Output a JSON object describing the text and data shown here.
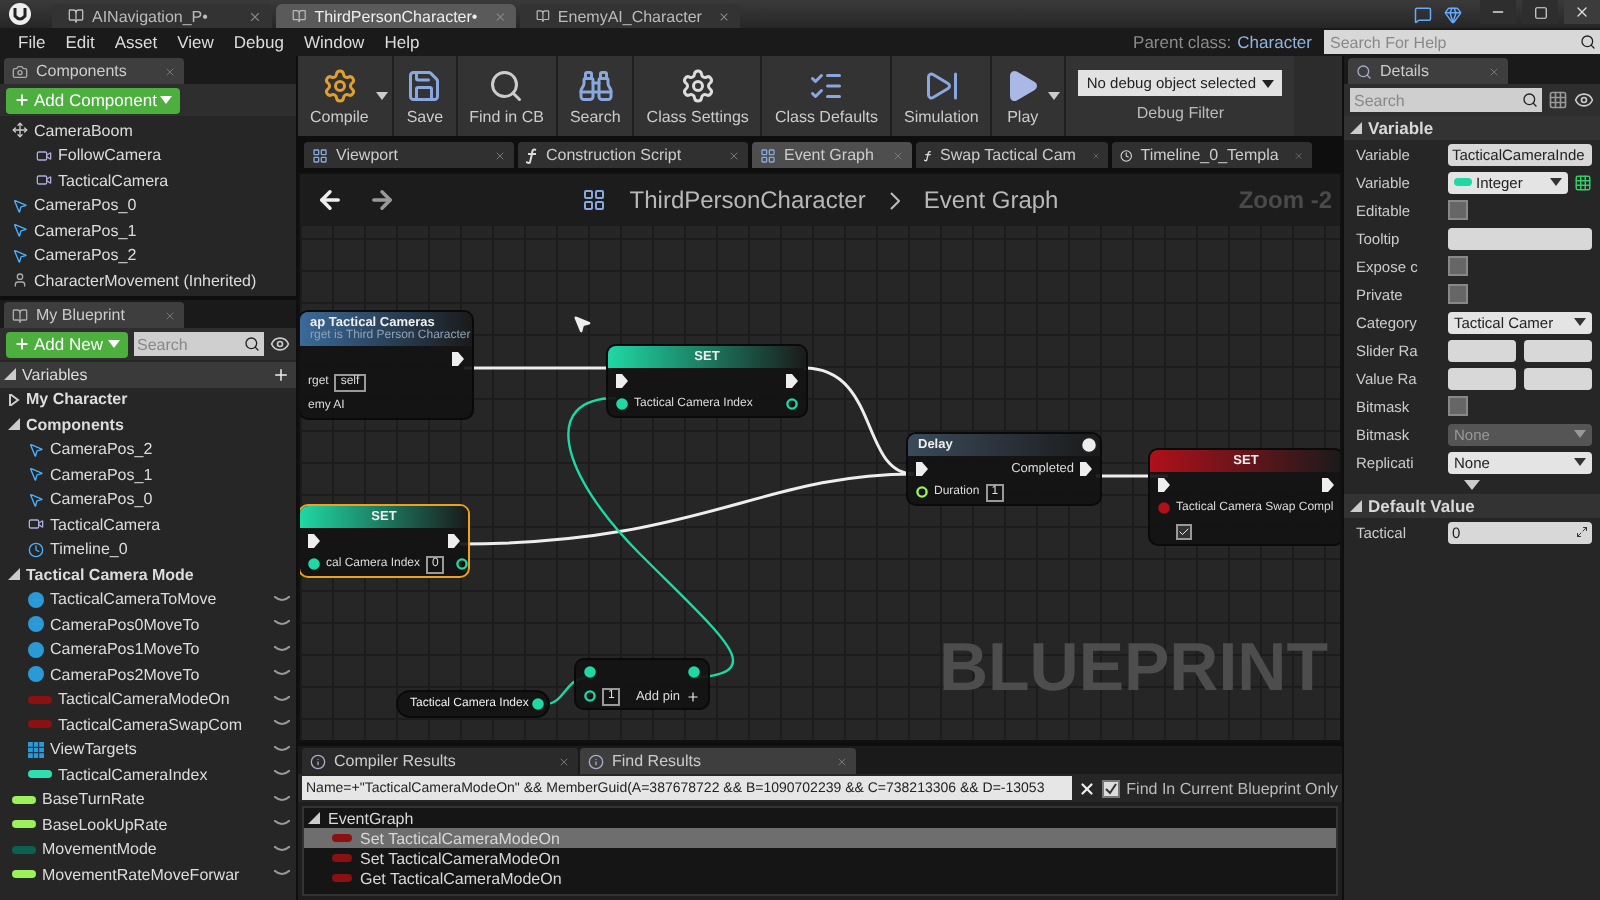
{
  "title_bar": {
    "tabs": [
      {
        "label": "AINavigation_P•",
        "selected": false
      },
      {
        "label": "ThirdPersonCharacter•",
        "selected": true
      },
      {
        "label": "EnemyAI_Character",
        "selected": false
      }
    ]
  },
  "menu": [
    "File",
    "Edit",
    "Asset",
    "View",
    "Debug",
    "Window",
    "Help"
  ],
  "parent_class": {
    "label": "Parent class:",
    "value": "Character"
  },
  "help_search": {
    "placeholder": "Search For Help"
  },
  "components_panel": {
    "tab": "Components",
    "add_button": "Add Component",
    "items": [
      {
        "label": "CameraBoom",
        "kind": "spring_arm",
        "children": [
          {
            "label": "FollowCamera",
            "kind": "camera"
          },
          {
            "label": "TacticalCamera",
            "kind": "camera"
          }
        ]
      },
      {
        "label": "CameraPos_0",
        "kind": "scene"
      },
      {
        "label": "CameraPos_1",
        "kind": "scene"
      },
      {
        "label": "CameraPos_2",
        "kind": "scene"
      },
      {
        "label": "CharacterMovement (Inherited)",
        "kind": "movement"
      }
    ]
  },
  "my_blueprint": {
    "tab": "My Blueprint",
    "add_button": "Add New",
    "search": {
      "placeholder": "Search"
    },
    "items": [
      {
        "label": "Variables",
        "kind": "header",
        "expanded": true,
        "children": [
          {
            "label": "My Character",
            "kind": "category",
            "expanded": false
          },
          {
            "label": "Components",
            "kind": "category",
            "expanded": true,
            "children": [
              {
                "label": "CameraPos_2",
                "kind": "scene"
              },
              {
                "label": "CameraPos_1",
                "kind": "scene"
              },
              {
                "label": "CameraPos_0",
                "kind": "scene"
              },
              {
                "label": "TacticalCamera",
                "kind": "camera"
              },
              {
                "label": "Timeline_0",
                "kind": "timeline"
              }
            ]
          },
          {
            "label": "Tactical Camera Mode",
            "kind": "category",
            "expanded": true,
            "children": [
              {
                "label": "TacticalCameraToMove",
                "kind": "object",
                "color": "#2a9ad6"
              },
              {
                "label": "CameraPos0MoveTo",
                "kind": "object",
                "color": "#2a9ad6"
              },
              {
                "label": "CameraPos1MoveTo",
                "kind": "object",
                "color": "#2a9ad6"
              },
              {
                "label": "CameraPos2MoveTo",
                "kind": "object",
                "color": "#2a9ad6"
              },
              {
                "label": "TacticalCameraModeOn",
                "kind": "variable",
                "color": "#8b1010"
              },
              {
                "label": "TacticalCameraSwapCom",
                "kind": "variable",
                "color": "#8b1010"
              },
              {
                "label": "ViewTargets",
                "kind": "array",
                "color": "#2a9ad6"
              },
              {
                "label": "TacticalCameraIndex",
                "kind": "variable",
                "color": "#2ee0b0"
              }
            ]
          },
          {
            "label": "BaseTurnRate",
            "kind": "variable",
            "color": "#9cf05a"
          },
          {
            "label": "BaseLookUpRate",
            "kind": "variable",
            "color": "#9cf05a"
          },
          {
            "label": "MovementMode",
            "kind": "variable",
            "color": "#0b6050"
          },
          {
            "label": "MovementRateMoveForwar",
            "kind": "variable",
            "color": "#9cf05a"
          }
        ]
      }
    ]
  },
  "toolbar": {
    "buttons": [
      {
        "label": "Compile",
        "kind": "compile",
        "dropdown": true
      },
      {
        "label": "Save",
        "kind": "save",
        "dropdown": false
      },
      {
        "label": "Find in CB",
        "kind": "find",
        "dropdown": false
      },
      {
        "label": "Search",
        "kind": "search",
        "dropdown": false
      },
      {
        "label": "Class Settings",
        "kind": "settings",
        "dropdown": false
      },
      {
        "label": "Class Defaults",
        "kind": "defaults",
        "dropdown": false
      },
      {
        "label": "Simulation",
        "kind": "simulation",
        "dropdown": false
      },
      {
        "label": "Play",
        "kind": "play",
        "dropdown": true
      }
    ],
    "debug": {
      "value": "No debug object selected",
      "label": "Debug Filter"
    }
  },
  "doc_tabs": [
    {
      "label": "Viewport",
      "kind": "viewport",
      "selected": false
    },
    {
      "label": "Construction Script",
      "kind": "function",
      "selected": false
    },
    {
      "label": "Event Graph",
      "kind": "graph",
      "selected": true
    },
    {
      "label": "Swap Tactical Cam",
      "kind": "function",
      "selected": false
    },
    {
      "label": "Timeline_0_Templa",
      "kind": "timeline",
      "selected": false
    }
  ],
  "graph": {
    "breadcrumb": [
      "ThirdPersonCharacter",
      "Event Graph"
    ],
    "zoom": "Zoom -2",
    "watermark": "BLUEPRINT",
    "nodes": [
      {
        "kind": "event",
        "title": "ap Tactical Cameras",
        "subtitle": "rget is Third Person Character",
        "pins": [
          {
            "label": "rget",
            "value": "self"
          },
          {
            "label": "emy AI"
          }
        ],
        "selected": false
      },
      {
        "kind": "set",
        "color": "#1fd8a4",
        "title": "SET",
        "pins": [
          {
            "label": "Tactical Camera Index"
          }
        ],
        "selected": false
      },
      {
        "kind": "delay",
        "title": "Delay",
        "output": "Completed",
        "pins": [
          {
            "label": "Duration",
            "value": "1"
          }
        ],
        "selected": false
      },
      {
        "kind": "set",
        "color": "#b0101a",
        "title": "SET",
        "pins": [
          {
            "label": "Tactical Camera Swap Compl",
            "checked": true
          }
        ],
        "selected": false
      },
      {
        "kind": "set",
        "color": "#1fd8a4",
        "title": "SET",
        "pins": [
          {
            "label": "cal Camera Index",
            "value": "0"
          }
        ],
        "selected": true
      },
      {
        "kind": "getter",
        "color": "#1fd8a4",
        "title": "Tactical Camera Index",
        "selected": false
      },
      {
        "kind": "operator",
        "pins": [
          {
            "value": "1"
          }
        ],
        "add_pin": "Add pin",
        "selected": false
      }
    ]
  },
  "results_panel": {
    "tabs": [
      {
        "label": "Compiler Results",
        "selected": false
      },
      {
        "label": "Find Results",
        "selected": true
      }
    ],
    "query": "Name=+\"TacticalCameraModeOn\" && MemberGuid(A=387678722 && B=1090702239 && C=738213306 && D=-13053",
    "option": {
      "label": "Find In Current Blueprint Only",
      "checked": true
    },
    "results": [
      {
        "label": "EventGraph",
        "expanded": true,
        "children": [
          {
            "label": "Set TacticalCameraModeOn",
            "selected": true
          },
          {
            "label": "Set TacticalCameraModeOn",
            "selected": false
          },
          {
            "label": "Get TacticalCameraModeOn",
            "selected": false
          }
        ]
      }
    ]
  },
  "details": {
    "tab": "Details",
    "search": {
      "placeholder": "Search"
    },
    "sections": [
      {
        "title": "Variable",
        "expanded": true,
        "rows": [
          {
            "label": "Variable",
            "kind": "field",
            "value": "TacticalCameraInde"
          },
          {
            "label": "Variable",
            "kind": "type",
            "value": "Integer"
          },
          {
            "label": "Editable",
            "kind": "checkbox",
            "checked": false
          },
          {
            "label": "Tooltip",
            "kind": "field"
          },
          {
            "label": "Expose c",
            "kind": "checkbox",
            "checked": false
          },
          {
            "label": "Private",
            "kind": "checkbox",
            "checked": false
          },
          {
            "label": "Category",
            "kind": "dropdown",
            "value": "Tactical Camer",
            "disabled": false
          },
          {
            "label": "Slider Ra",
            "kind": "range"
          },
          {
            "label": "Value Ra",
            "kind": "range"
          },
          {
            "label": "Bitmask",
            "kind": "checkbox",
            "checked": false
          },
          {
            "label": "Bitmask",
            "kind": "dropdown",
            "value": "None",
            "disabled": true
          },
          {
            "label": "Replicati",
            "kind": "dropdown",
            "value": "None",
            "disabled": false
          }
        ]
      },
      {
        "title": "Default Value",
        "expanded": true,
        "rows": [
          {
            "label": "Tactical",
            "kind": "field",
            "value": "0"
          }
        ]
      }
    ]
  }
}
